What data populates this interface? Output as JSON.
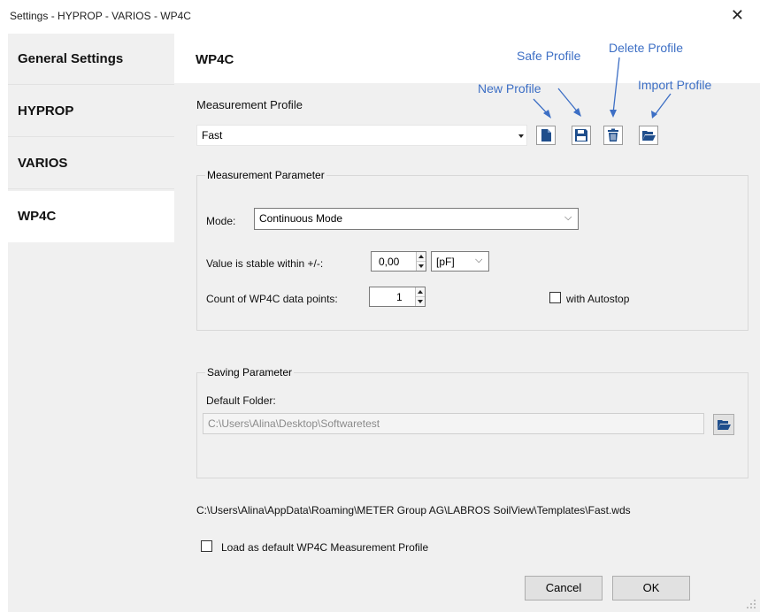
{
  "window": {
    "title": "Settings - HYPROP - VARIOS - WP4C",
    "close_glyph": "✕"
  },
  "sidebar": {
    "items": [
      {
        "label": "General Settings",
        "active": false
      },
      {
        "label": "HYPROP",
        "active": false
      },
      {
        "label": "VARIOS",
        "active": false
      },
      {
        "label": "WP4C",
        "active": true
      }
    ]
  },
  "main": {
    "header": "WP4C",
    "profile": {
      "label": "Measurement Profile",
      "selected": "Fast"
    },
    "annotations": {
      "new_profile": "New Profile",
      "safe_profile": "Safe Profile",
      "delete_profile": "Delete Profile",
      "import_profile": "Import Profile"
    },
    "toolbar": {
      "new_icon": "new-file-icon",
      "save_icon": "save-icon",
      "delete_icon": "trash-icon",
      "import_icon": "folder-open-icon",
      "icon_color": "#1f4e8c"
    },
    "measurement": {
      "title": "Measurement Parameter",
      "mode_label": "Mode:",
      "mode_value": "Continuous Mode",
      "stable_label": "Value is stable within +/-:",
      "stable_value": "0,00",
      "unit_value": "[pF]",
      "count_label": "Count of WP4C data points:",
      "count_value": "1",
      "autostop_label": "with Autostop",
      "autostop_checked": false
    },
    "saving": {
      "title": "Saving Parameter",
      "folder_label": "Default Folder:",
      "folder_value": "C:\\Users\\Alina\\Desktop\\Softwaretest"
    },
    "template_path": "C:\\Users\\Alina\\AppData\\Roaming\\METER Group AG\\LABROS SoilView\\Templates\\Fast.wds",
    "load_default": {
      "label": "Load as default WP4C Measurement Profile",
      "checked": false
    },
    "buttons": {
      "cancel": "Cancel",
      "ok": "OK"
    }
  }
}
